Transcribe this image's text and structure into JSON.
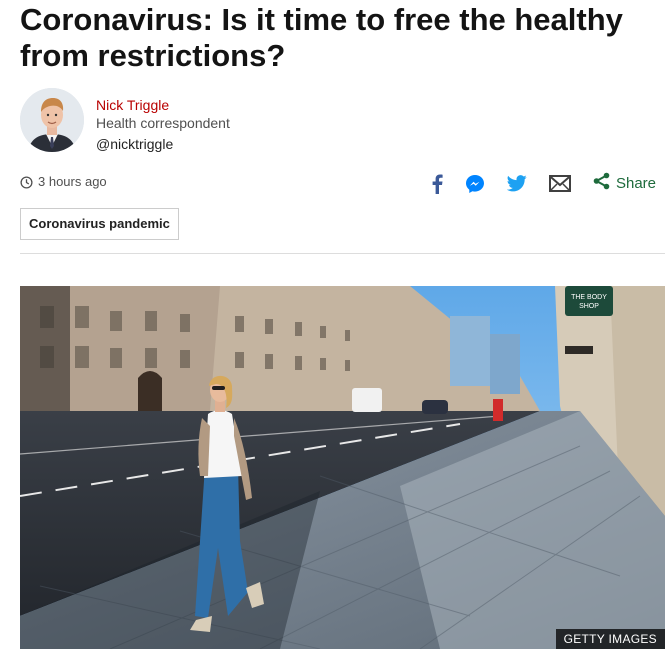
{
  "article": {
    "headline": "Coronavirus: Is it time to free the healthy from restrictions?"
  },
  "author": {
    "name": "Nick Triggle",
    "role": "Health correspondent",
    "handle": "@nicktriggle"
  },
  "meta": {
    "timestamp": "3 hours ago"
  },
  "share": {
    "label": "Share",
    "icons": [
      "facebook-icon",
      "messenger-icon",
      "twitter-icon",
      "email-icon",
      "share-icon"
    ]
  },
  "tag": {
    "label": "Coronavirus pandemic"
  },
  "image": {
    "credit": "GETTY IMAGES",
    "shop_sign": "THE BODY SHOP"
  },
  "colors": {
    "author_accent": "#b80000",
    "facebook": "#3b5998",
    "messenger": "#0084ff",
    "twitter": "#1da1f2",
    "share": "#1e6b3c"
  }
}
